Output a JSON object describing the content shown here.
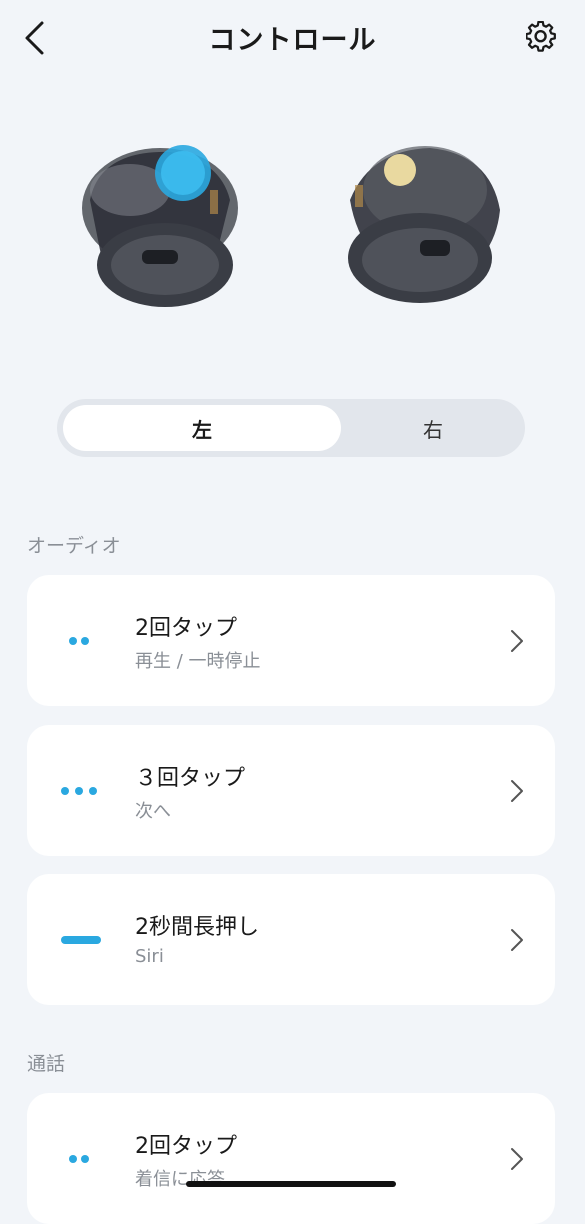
{
  "header": {
    "title": "コントロール",
    "back_icon": "chevron-left-icon",
    "settings_icon": "gear-icon"
  },
  "side_toggle": {
    "left_label": "左",
    "right_label": "右",
    "selected": "左"
  },
  "audio_section": {
    "label": "オーディオ",
    "items": [
      {
        "gesture_icon": "double-dot-icon",
        "title": "2回タップ",
        "action": "再生 / 一時停止"
      },
      {
        "gesture_icon": "triple-dot-icon",
        "title": "３回タップ",
        "action": "次へ"
      },
      {
        "gesture_icon": "long-bar-icon",
        "title": "2秒間長押し",
        "action": "Siri"
      }
    ]
  },
  "call_section": {
    "label": "通話",
    "items": [
      {
        "gesture_icon": "double-dot-icon",
        "title": "2回タップ",
        "action": "着信に応答"
      }
    ]
  },
  "colors": {
    "accent": "#2aa8e0",
    "background": "#f2f5f9",
    "card": "#ffffff"
  }
}
